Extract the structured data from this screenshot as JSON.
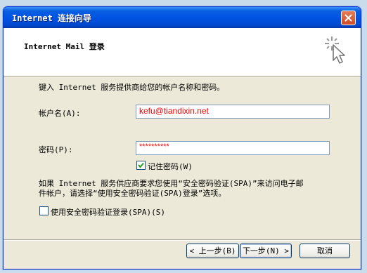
{
  "window": {
    "title": "Internet 连接向导"
  },
  "header": {
    "title": "Internet Mail 登录"
  },
  "body": {
    "intro": "键入 Internet 服务提供商给您的帐户名称和密码。",
    "account_label": "帐户名(A):",
    "account_value": "kefu@tiandixin.net",
    "password_label": "密码(P):",
    "password_value": "**********",
    "remember_label": "记住密码(W)",
    "remember_checked": true,
    "spa_note_line1": "如果 Internet 服务供应商要求您使用“安全密码验证(SPA)”来访问电子邮",
    "spa_note_line2": "件帐户，请选择“使用安全密码验证(SPA)登录”选项。",
    "spa_label": "使用安全密码验证登录(SPA)(S)",
    "spa_checked": false
  },
  "footer": {
    "back_label": "< 上一步(B)",
    "next_label": "下一步(N) >",
    "cancel_label": "取消"
  },
  "colors": {
    "title_bar": "#0054e3",
    "input_text": "#ff0000",
    "dialog_bg": "#ece9d8"
  }
}
